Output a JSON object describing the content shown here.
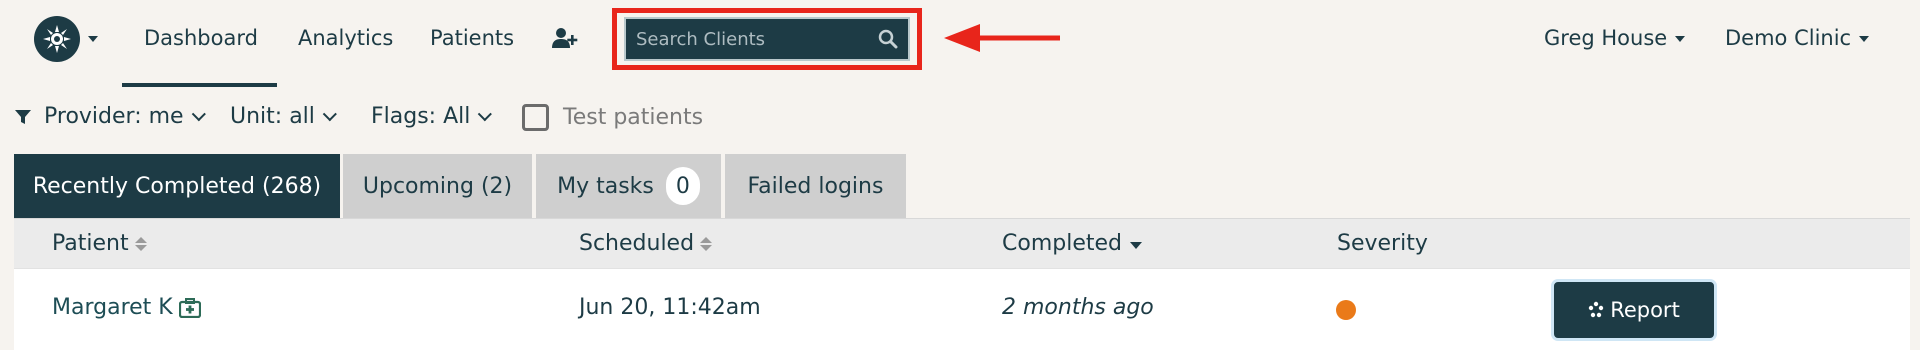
{
  "nav": {
    "links": [
      "Dashboard",
      "Analytics",
      "Patients"
    ],
    "search_placeholder": "Search Clients",
    "user": "Greg House",
    "clinic": "Demo Clinic"
  },
  "filters": {
    "provider": "Provider: me",
    "unit": "Unit: all",
    "flags": "Flags: All",
    "test_patients": "Test patients"
  },
  "tabs": [
    {
      "label": "Recently Completed (268)"
    },
    {
      "label": "Upcoming (2)"
    },
    {
      "label": "My tasks",
      "badge": "0"
    },
    {
      "label": "Failed logins"
    }
  ],
  "table": {
    "headers": [
      "Patient",
      "Scheduled",
      "Completed",
      "Severity"
    ],
    "rows": [
      {
        "patient": "Margaret K",
        "scheduled": "Jun 20, 11:42am",
        "completed": "2 months ago",
        "severity_color": "#ea7a19",
        "action": "Report"
      }
    ]
  },
  "colors": {
    "primary": "#1d3b45",
    "highlight": "#e8251b",
    "severity_medium": "#ea7a19"
  }
}
